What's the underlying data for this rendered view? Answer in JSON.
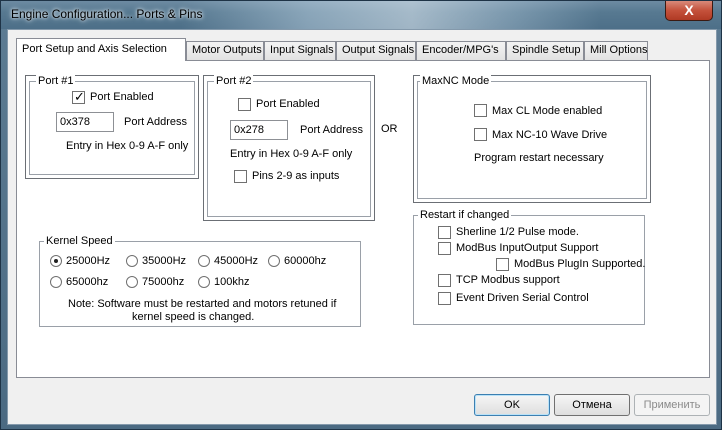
{
  "window": {
    "title": "Engine Configuration... Ports & Pins",
    "close_label": "X"
  },
  "tabs": [
    {
      "label": "Port Setup and Axis Selection",
      "active": true
    },
    {
      "label": "Motor Outputs"
    },
    {
      "label": "Input Signals"
    },
    {
      "label": "Output Signals"
    },
    {
      "label": "Encoder/MPG's"
    },
    {
      "label": "Spindle Setup"
    },
    {
      "label": "Mill Options"
    }
  ],
  "port1": {
    "legend": "Port #1",
    "enabled_label": "Port Enabled",
    "enabled": true,
    "address_value": "0x378",
    "address_label": "Port Address",
    "hint": "Entry in Hex 0-9 A-F only"
  },
  "port2": {
    "legend": "Port #2",
    "enabled_label": "Port Enabled",
    "enabled": false,
    "address_value": "0x278",
    "address_label": "Port Address",
    "hint": "Entry in Hex 0-9 A-F only",
    "pins_label": "Pins 2-9 as inputs",
    "pins_checked": false
  },
  "or_label": "OR",
  "maxnc": {
    "legend": "MaxNC Mode",
    "cl_label": "Max CL Mode enabled",
    "wave_label": "Max NC-10 Wave Drive",
    "note": "Program restart necessary"
  },
  "kernel": {
    "legend": "Kernel Speed",
    "options": [
      "25000Hz",
      "35000Hz",
      "45000Hz",
      "60000hz",
      "65000hz",
      "75000hz",
      "100khz"
    ],
    "selected": "25000Hz",
    "note_line1": "Note: Software must be restarted and motors retuned if",
    "note_line2": "kernel speed is changed."
  },
  "restart": {
    "legend": "Restart if changed",
    "sherline": "Sherline 1/2 Pulse mode.",
    "modbus_io": "ModBus InputOutput Support",
    "modbus_plugin": "ModBus PlugIn Supported.",
    "tcp_modbus": "TCP Modbus support",
    "event_serial": "Event Driven Serial Control"
  },
  "buttons": {
    "ok": "OK",
    "cancel": "Отмена",
    "apply": "Применить"
  }
}
